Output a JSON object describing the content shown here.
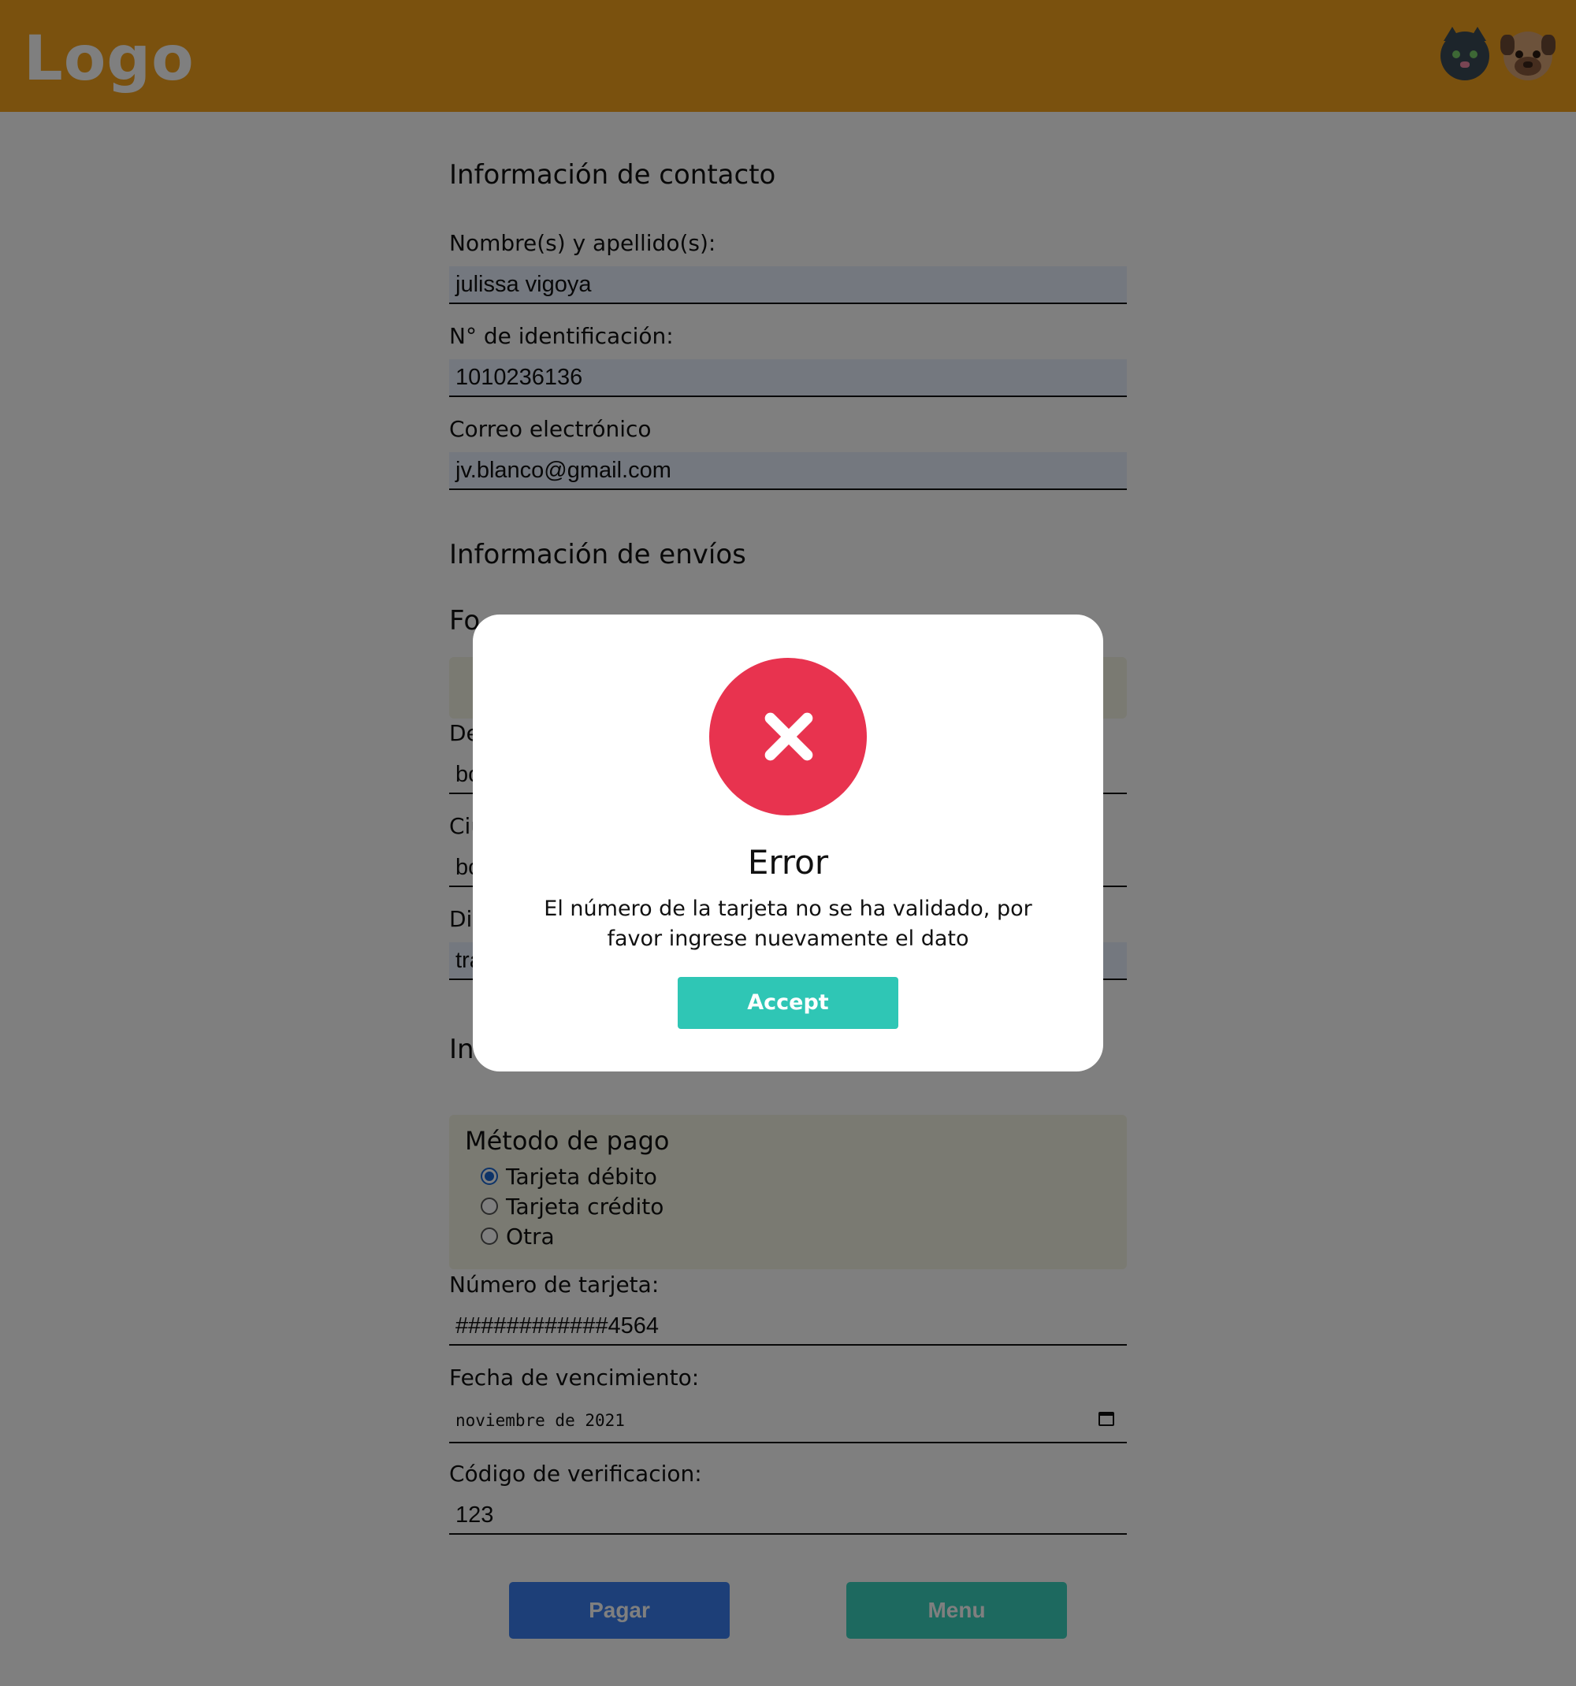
{
  "header": {
    "logo": "Logo",
    "avatars": [
      "cat-avatar",
      "dog-avatar"
    ],
    "background_color": "#f4a21c"
  },
  "contact": {
    "title": "Información de contacto",
    "name_label": "Nombre(s) y apellido(s):",
    "name_value": "julissa vigoya",
    "id_label": "N° de identificación:",
    "id_value": "1010236136",
    "email_label": "Correo electrónico",
    "email_value": "jv.blanco@gmail.com"
  },
  "shipping": {
    "title": "Información de envíos",
    "visible_fragments": {
      "form_heading": "Fo",
      "department_label": "De",
      "department_value": "bo",
      "city_label": "Ciu",
      "city_value": "bo",
      "address_label": "Dir",
      "address_value": "tra"
    }
  },
  "payment": {
    "title_fragment": "In",
    "method_legend": "Método de pago",
    "methods": [
      {
        "label": "Tarjeta débito",
        "checked": true
      },
      {
        "label": "Tarjeta crédito",
        "checked": false
      },
      {
        "label": "Otra",
        "checked": false
      }
    ],
    "card_label": "Número de tarjeta:",
    "card_value": "############4564",
    "expiry_label": "Fecha de vencimiento:",
    "expiry_value": "noviembre de 2021",
    "cvv_label": "Código de verificacion:",
    "cvv_value": "123"
  },
  "actions": {
    "pay_label": "Pagar",
    "menu_label": "Menu",
    "pay_color": "#3a7ff0",
    "menu_color": "#3bd3be"
  },
  "modal": {
    "icon": "error-x-icon",
    "title": "Error",
    "message": "El número de la tarjeta no se ha validado, por favor ingrese nuevamente el dato",
    "accept_label": "Accept",
    "icon_color": "#e8334f",
    "accept_color": "#2fc6b5"
  }
}
